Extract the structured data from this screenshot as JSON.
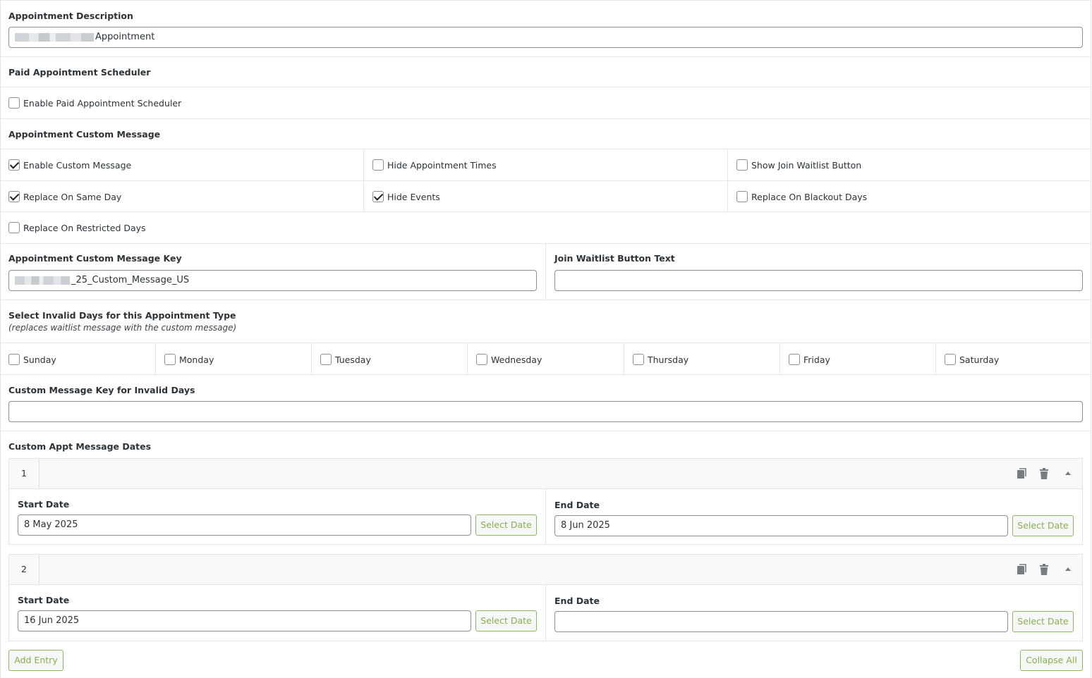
{
  "appointment_description": {
    "label": "Appointment Description",
    "value": "Appointment"
  },
  "paid_scheduler": {
    "heading": "Paid Appointment Scheduler",
    "enable_label": "Enable Paid Appointment Scheduler",
    "enable_checked": false
  },
  "custom_message": {
    "heading": "Appointment Custom Message",
    "options": [
      {
        "label": "Enable Custom Message",
        "checked": true
      },
      {
        "label": "Hide Appointment Times",
        "checked": false
      },
      {
        "label": "Show Join Waitlist Button",
        "checked": false
      },
      {
        "label": "Replace On Same Day",
        "checked": true
      },
      {
        "label": "Hide Events",
        "checked": true
      },
      {
        "label": "Replace On Blackout Days",
        "checked": false
      },
      {
        "label": "Replace On Restricted Days",
        "checked": false
      }
    ]
  },
  "message_key": {
    "label": "Appointment Custom Message Key",
    "value": "_25_Custom_Message_US"
  },
  "waitlist_text": {
    "label": "Join Waitlist Button Text",
    "value": ""
  },
  "invalid_days": {
    "heading": "Select Invalid Days for this Appointment Type",
    "subheading": "(replaces waitlist message with the custom message)",
    "days": [
      {
        "label": "Sunday",
        "checked": false
      },
      {
        "label": "Monday",
        "checked": false
      },
      {
        "label": "Tuesday",
        "checked": false
      },
      {
        "label": "Wednesday",
        "checked": false
      },
      {
        "label": "Thursday",
        "checked": false
      },
      {
        "label": "Friday",
        "checked": false
      },
      {
        "label": "Saturday",
        "checked": false
      }
    ]
  },
  "invalid_days_key": {
    "label": "Custom Message Key for Invalid Days",
    "value": ""
  },
  "message_dates": {
    "heading": "Custom Appt Message Dates",
    "start_label": "Start Date",
    "end_label": "End Date",
    "select_date_label": "Select Date",
    "entries": [
      {
        "number": "1",
        "start": "8 May 2025",
        "end": "8 Jun 2025"
      },
      {
        "number": "2",
        "start": "16 Jun 2025",
        "end": ""
      }
    ],
    "add_entry_label": "Add Entry",
    "collapse_all_label": "Collapse All"
  },
  "colors": {
    "accent_green": "#86b04b",
    "border": "#8c8f94",
    "text": "#2c3338"
  },
  "icons": [
    "copy-icon",
    "trash-icon",
    "caret-up-icon"
  ]
}
